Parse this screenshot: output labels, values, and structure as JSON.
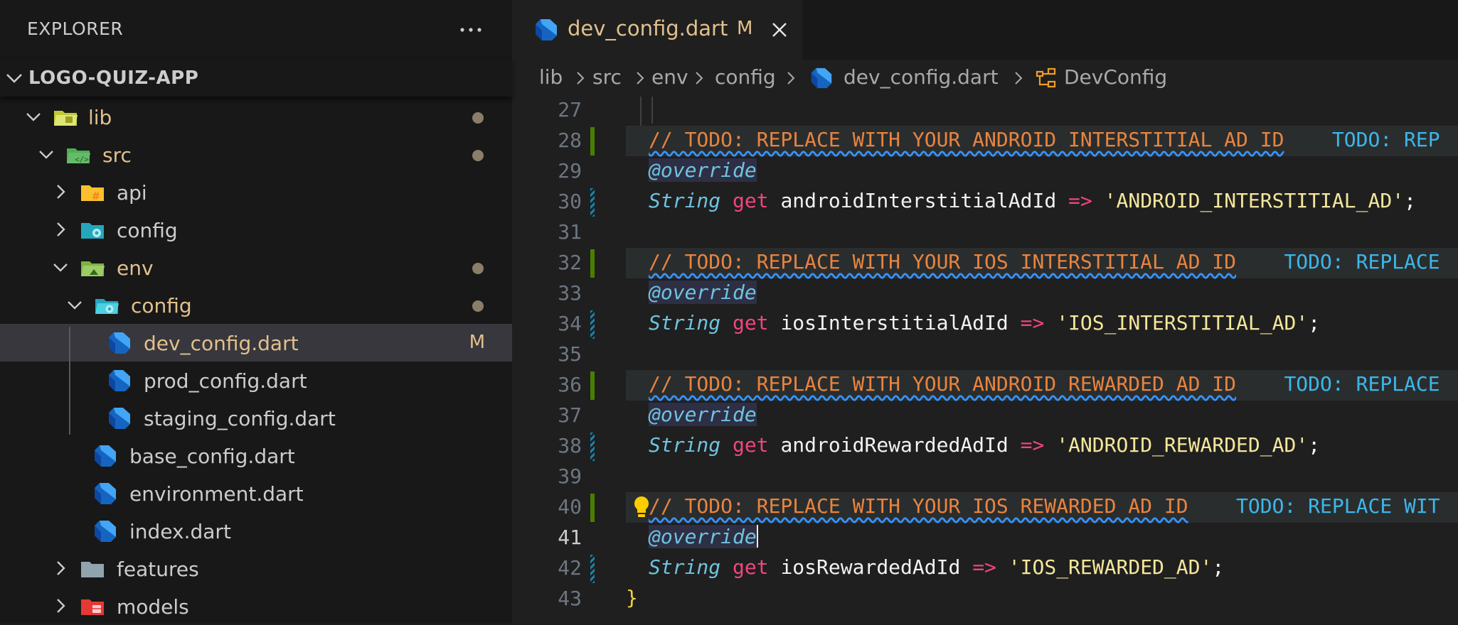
{
  "sidebar": {
    "title": "EXPLORER",
    "project": "LOGO-QUIZ-APP",
    "tree": [
      {
        "label": "lib",
        "modified_dot": true
      },
      {
        "label": "src",
        "modified_dot": true
      },
      {
        "label": "api"
      },
      {
        "label": "config"
      },
      {
        "label": "env",
        "modified_dot": true
      },
      {
        "label": "config",
        "modified_dot": true
      },
      {
        "label": "dev_config.dart",
        "badge": "M"
      },
      {
        "label": "prod_config.dart"
      },
      {
        "label": "staging_config.dart"
      },
      {
        "label": "base_config.dart"
      },
      {
        "label": "environment.dart"
      },
      {
        "label": "index.dart"
      },
      {
        "label": "features"
      },
      {
        "label": "models"
      }
    ]
  },
  "tab": {
    "label": "dev_config.dart",
    "badge": "M"
  },
  "breadcrumb": [
    "lib",
    "src",
    "env",
    "config",
    "dev_config.dart",
    "DevConfig"
  ],
  "code": {
    "lines": {
      "27": "27",
      "28": "28",
      "29": "29",
      "30": "30",
      "31": "31",
      "32": "32",
      "33": "33",
      "34": "34",
      "35": "35",
      "36": "36",
      "37": "37",
      "38": "38",
      "39": "39",
      "40": "40",
      "41": "41",
      "42": "42",
      "43": "43"
    },
    "l28": {
      "comment": "// TODO: REPLACE WITH YOUR ANDROID INTERSTITIAL AD ID",
      "hint": "TODO: REP"
    },
    "l29": {
      "anno": "@override"
    },
    "l30": {
      "type": "String",
      "kw": "get",
      "ident": "androidInterstitialAdId",
      "op": "=>",
      "str": "'ANDROID_INTERSTITIAL_AD'",
      "punc": ";"
    },
    "l32": {
      "comment": "// TODO: REPLACE WITH YOUR IOS INTERSTITIAL AD ID",
      "hint": "TODO: REPLACE"
    },
    "l33": {
      "anno": "@override"
    },
    "l34": {
      "type": "String",
      "kw": "get",
      "ident": "iosInterstitialAdId",
      "op": "=>",
      "str": "'IOS_INTERSTITIAL_AD'",
      "punc": ";"
    },
    "l36": {
      "comment": "// TODO: REPLACE WITH YOUR ANDROID REWARDED AD ID",
      "hint": "TODO: REPLACE"
    },
    "l37": {
      "anno": "@override"
    },
    "l38": {
      "type": "String",
      "kw": "get",
      "ident": "androidRewardedAdId",
      "op": "=>",
      "str": "'ANDROID_REWARDED_AD'",
      "punc": ";"
    },
    "l40": {
      "comment": "// TODO: REPLACE WITH YOUR IOS REWARDED AD ID",
      "hint": "TODO: REPLACE WIT"
    },
    "l41": {
      "anno": "@override"
    },
    "l42": {
      "type": "String",
      "kw": "get",
      "ident": "iosRewardedAdId",
      "op": "=>",
      "str": "'IOS_REWARDED_AD'",
      "punc": ";"
    },
    "l43": {
      "brace": "}"
    }
  },
  "colors": {
    "accent_modified": "#e2c08d",
    "git_added": "#487e02",
    "git_modified": "#1b81a8",
    "comment": "#e8843f",
    "todo_hint": "#3cb7ea"
  }
}
